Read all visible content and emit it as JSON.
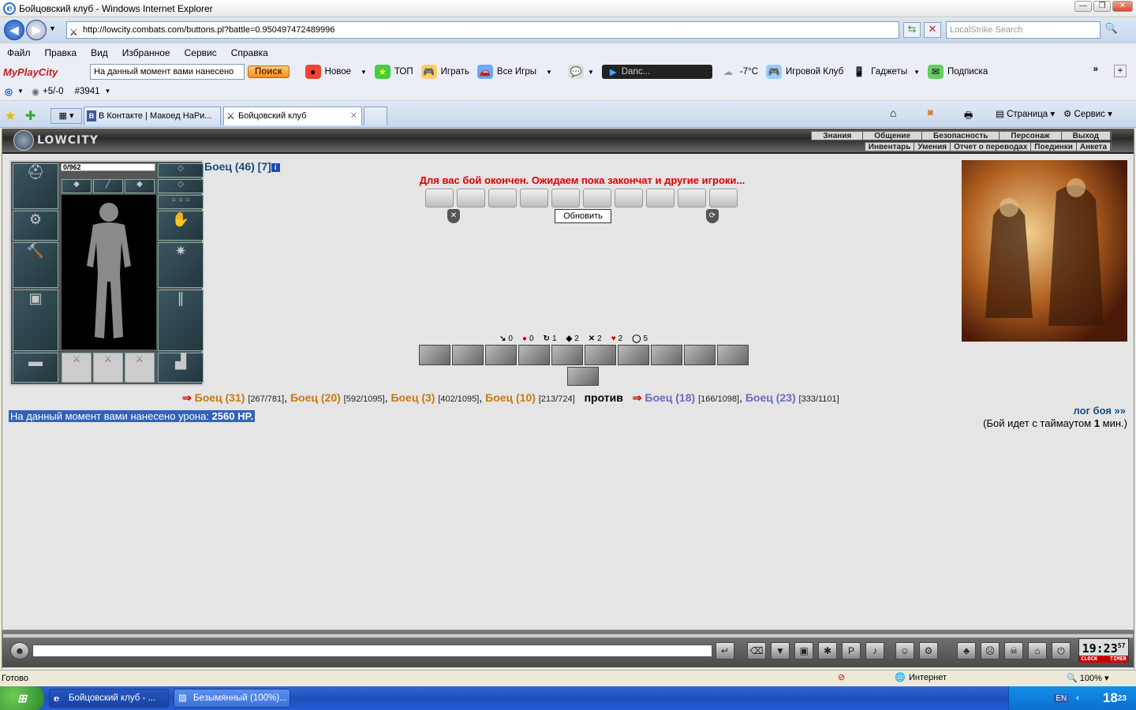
{
  "window": {
    "title": "Бойцовский клуб - Windows Internet Explorer"
  },
  "address": {
    "url": "http://lowcity.combats.com/buttons.pl?battle=0.950497472489996",
    "search_placeholder": "LocalStrike Search"
  },
  "menu": [
    "Файл",
    "Правка",
    "Вид",
    "Избранное",
    "Сервис",
    "Справка"
  ],
  "toolbar": {
    "combo": "На данный момент вами нанесено",
    "search_btn": "Поиск",
    "items": [
      {
        "label": "Новое",
        "icon": "new-icon"
      },
      {
        "label": "ТОП",
        "icon": "star-icon"
      },
      {
        "label": "Играть",
        "icon": "play-icon"
      },
      {
        "label": "Все Игры",
        "icon": "games-icon"
      }
    ],
    "player": "Danc...",
    "weather": "-7°C",
    "right_items": [
      "Игровой Клуб",
      "Гаджеты",
      "Подписка"
    ]
  },
  "toolbar2": {
    "score": "+5/-0",
    "id": "#3941"
  },
  "tabs": [
    {
      "label": "В Контакте | Макоед НаРи..."
    },
    {
      "label": "Бойцовский клуб"
    }
  ],
  "cmdbar": {
    "page": "Страница",
    "tools": "Сервис"
  },
  "game": {
    "logo": "LOWCITY",
    "menu_top": [
      "Знания",
      "Общение",
      "Безопасность",
      "Персонаж",
      "Выход"
    ],
    "menu_bottom": [
      "Инвентарь",
      "Умения",
      "Отчет о переводах",
      "Поединки",
      "Анкета"
    ],
    "hp": "0/962",
    "fighter": "Боец (46) [7]",
    "end_msg": "Для вас бой окончен. Ожидаем пока закончат и другие игроки...",
    "refresh_btn": "Обновить",
    "counters": [
      "0",
      "0",
      "1",
      "2",
      "2",
      "2",
      "5"
    ],
    "team1": [
      {
        "name": "Боец (31)",
        "hp": "[267/781]"
      },
      {
        "name": "Боец (20)",
        "hp": "[592/1095]"
      },
      {
        "name": "Боец (3)",
        "hp": "[402/1095]"
      },
      {
        "name": "Боец (10)",
        "hp": "[213/724]"
      }
    ],
    "vs": "против",
    "team2": [
      {
        "name": "Боец (18)",
        "hp": "[166/1098]"
      },
      {
        "name": "Боец (23)",
        "hp": "[333/1101]"
      }
    ],
    "damage_label": "На данный момент вами нанесено урона:",
    "damage_value": "2560 HP.",
    "log": "лог боя »»",
    "timeout_pre": "(Бой идет с таймаутом ",
    "timeout_val": "1",
    "timeout_post": " мин.)",
    "clock": "19:23",
    "clock_sec": "57",
    "clock_l": "CLOCK",
    "clock_r": "TIMER"
  },
  "status": {
    "text": "Готово",
    "zone": "Интернет",
    "zoom": "100%"
  },
  "taskbar": {
    "start": "",
    "tasks": [
      "Бойцовский клуб - ...",
      "Безымянный (100%)..."
    ],
    "lang": "EN",
    "time": "18",
    "time_min": "23"
  }
}
